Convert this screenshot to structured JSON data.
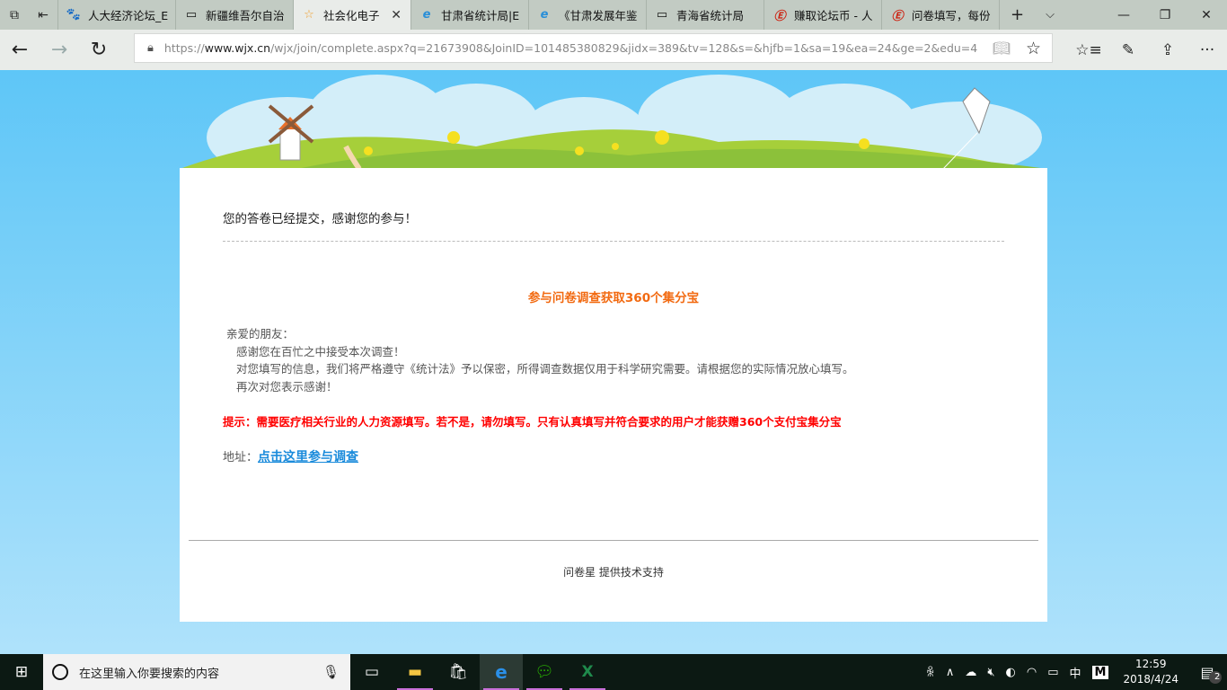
{
  "browser": {
    "tabs": [
      {
        "label": "人大经济论坛_E",
        "icon": "baidu-paw-icon"
      },
      {
        "label": "新疆维吾尔自治",
        "icon": "page-icon"
      },
      {
        "label": "社会化电子",
        "icon": "star-icon",
        "active": true
      },
      {
        "label": "甘肃省统计局|E",
        "icon": "ie-icon"
      },
      {
        "label": "《甘肃发展年鉴",
        "icon": "ie-icon"
      },
      {
        "label": "青海省统计局",
        "icon": "page-icon"
      },
      {
        "label": "赚取论坛币 - 人",
        "icon": "e-logo-icon"
      },
      {
        "label": "问卷填写，每份",
        "icon": "e-logo-icon"
      }
    ],
    "url_prefix": "https://",
    "url_domain": "www.wjx.cn",
    "url_path": "/wjx/join/complete.aspx?q=21673908&JoinID=101485380829&jidx=389&tv=128&s=&hjfb=1&sa=19&ea=24&ge=2&edu=4"
  },
  "page": {
    "submitted": "您的答卷已经提交，感谢您的参与！",
    "title": "参与问卷调查获取360个集分宝",
    "greeting": "亲爱的朋友：",
    "lines": [
      "感谢您在百忙之中接受本次调查！",
      "对您填写的信息，我们将严格遵守《统计法》予以保密，所得调查数据仅用于科学研究需要。请根据您的实际情况放心填写。",
      "再次对您表示感谢！"
    ],
    "hint": "提示：需要医疗相关行业的人力资源填写。若不是，请勿填写。只有认真填写并符合要求的用户才能获赠360个支付宝集分宝",
    "address_label": "地址：",
    "address_link": "点击这里参与调查",
    "footer": "问卷星 提供技术支持"
  },
  "taskbar": {
    "search_placeholder": "在这里输入你要搜索的内容",
    "ime": "中",
    "ime2": "M",
    "time": "12:59",
    "date": "2018/4/24",
    "notifications": "2"
  },
  "colors": {
    "title": "#f26a11",
    "hint": "#ff0000",
    "link": "#1a8bdb"
  }
}
